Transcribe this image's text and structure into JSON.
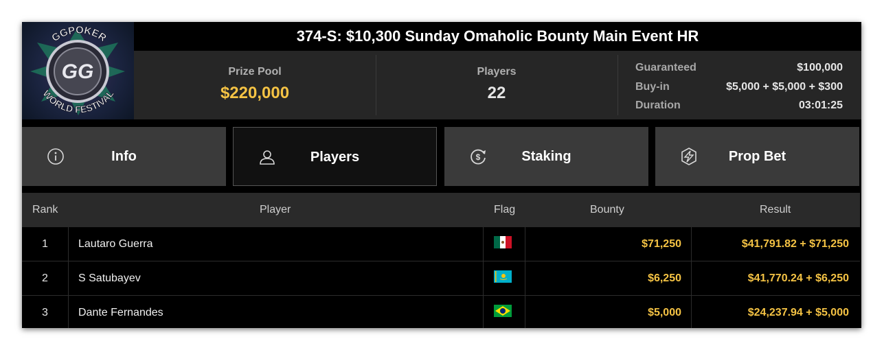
{
  "tournament": {
    "title": "374-S: $10,300 Sunday Omaholic Bounty Main Event HR",
    "logo_text": {
      "top": "GGPOKER",
      "bottom": "WORLD FESTIVAL",
      "center": "GG"
    }
  },
  "stats": {
    "prize_pool_label": "Prize Pool",
    "prize_pool_value": "$220,000",
    "players_label": "Players",
    "players_value": "22",
    "details": [
      {
        "label": "Guaranteed",
        "value": "$100,000"
      },
      {
        "label": "Buy-in",
        "value": "$5,000 + $5,000 + $300"
      },
      {
        "label": "Duration",
        "value": "03:01:25"
      }
    ]
  },
  "tabs": [
    {
      "label": "Info",
      "icon": "info-icon",
      "active": false
    },
    {
      "label": "Players",
      "icon": "user-icon",
      "active": true
    },
    {
      "label": "Staking",
      "icon": "dollar-refresh-icon",
      "active": false
    },
    {
      "label": "Prop Bet",
      "icon": "lightning-shield-icon",
      "active": false
    }
  ],
  "table": {
    "headers": {
      "rank": "Rank",
      "player": "Player",
      "flag": "Flag",
      "bounty": "Bounty",
      "result": "Result"
    },
    "rows": [
      {
        "rank": "1",
        "player": "Lautaro Guerra",
        "flag": "mexico-flag",
        "bounty": "$71,250",
        "result": "$41,791.82 + $71,250"
      },
      {
        "rank": "2",
        "player": "S Satubayev",
        "flag": "kazakhstan-flag",
        "bounty": "$6,250",
        "result": "$41,770.24 + $6,250"
      },
      {
        "rank": "3",
        "player": "Dante Fernandes",
        "flag": "brazil-flag",
        "bounty": "$5,000",
        "result": "$24,237.94 + $5,000"
      }
    ]
  },
  "colors": {
    "accent_gold": "#f5c344",
    "background": "#000000",
    "panel": "#262626",
    "tab": "#3a3a3a"
  }
}
